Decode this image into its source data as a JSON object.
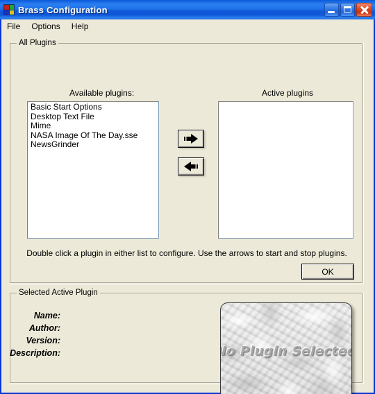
{
  "window": {
    "title": "Brass Configuration",
    "icon": "app-grid-icon",
    "controls": {
      "minimize": "Minimize",
      "maximize": "Maximize",
      "close": "Close"
    }
  },
  "menubar": {
    "items": [
      {
        "label": "File"
      },
      {
        "label": "Options"
      },
      {
        "label": "Help"
      }
    ]
  },
  "all_plugins_group": {
    "title": "All Plugins",
    "available_label": "Available plugins:",
    "active_label": "Active plugins",
    "available_plugins": [
      "Basic Start Options",
      "Desktop Text File",
      "Mime",
      "NASA Image Of The Day.sse",
      "NewsGrinder"
    ],
    "active_plugins": [],
    "move_right_button": "➡",
    "move_left_button": "⬅",
    "hint": "Double click a plugin in either list to configure. Use the arrows to start and stop plugins.",
    "ok_button": "OK"
  },
  "selected_plugin_group": {
    "title": "Selected Active Plugin",
    "fields": [
      {
        "label": "Name:",
        "value": ""
      },
      {
        "label": "Author:",
        "value": ""
      },
      {
        "label": "Version:",
        "value": ""
      },
      {
        "label": "Description:",
        "value": ""
      }
    ],
    "preview_text": "No Plugin Selected"
  },
  "colors": {
    "title_bar_blue": "#1f72ea",
    "window_frame_blue": "#0a36d4",
    "dialog_face": "#ece9d8",
    "group_border": "#aca899",
    "listbox_background": "#ffffff",
    "close_button_red": "#c8300c"
  }
}
